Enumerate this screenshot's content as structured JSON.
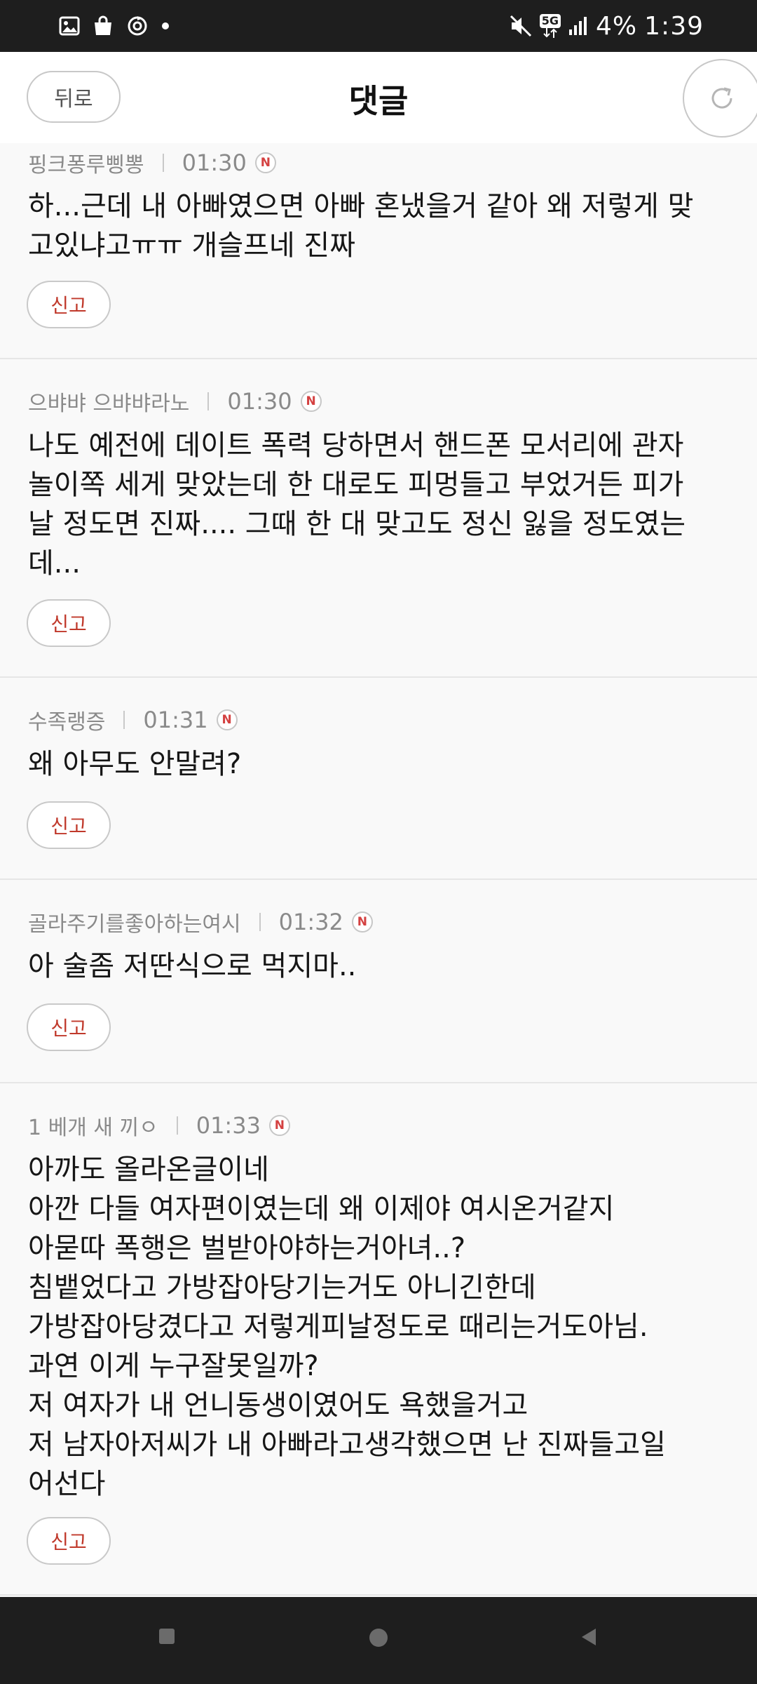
{
  "status_bar": {
    "left_icons": [
      "image-icon",
      "shopping-bag-icon",
      "sync-icon",
      "dot-icon"
    ],
    "network": "5G",
    "battery": "4%",
    "time": "1:39"
  },
  "header": {
    "back_label": "뒤로",
    "title": "댓글",
    "refresh_icon": "refresh-icon"
  },
  "comments": [
    {
      "author": "핑크퐁루삥뽕",
      "time": "01:30",
      "badge": "N",
      "body": "하...근데 내 아빠였으면 아빠 혼냈을거 같아 왜 저렇게 맞\n고있냐고ㅠㅠ 개슬프네 진짜",
      "report_label": "신고"
    },
    {
      "author": "으뱌뱌 으뱌뱌라노",
      "time": "01:30",
      "badge": "N",
      "body": "나도 예전에 데이트 폭력 당하면서 핸드폰 모서리에 관자\n놀이쪽 세게 맞았는데 한 대로도 피멍들고 부었거든 피가\n날 정도면 진짜.... 그때 한 대 맞고도 정신 잃을 정도였는\n데...",
      "report_label": "신고"
    },
    {
      "author": "수족랭증",
      "time": "01:31",
      "badge": "N",
      "body": "왜 아무도 안말려?",
      "report_label": "신고"
    },
    {
      "author": "골라주기를좋아하는여시",
      "time": "01:32",
      "badge": "N",
      "body": "아 술좀 저딴식으로 먹지마..",
      "report_label": "신고"
    },
    {
      "author": "1 베개 새 끼ㅇ",
      "time": "01:33",
      "badge": "N",
      "body": "아까도 올라온글이네\n아깐 다들 여자편이였는데 왜 이제야 여시온거같지\n아묻따 폭행은 벌받아야하는거아녀..?\n침뱉었다고 가방잡아당기는거도 아니긴한데\n가방잡아당겼다고 저렇게피날정도로 때리는거도아님.\n과연 이게 누구잘못일까?\n저 여자가 내 언니동생이였어도 욕했을거고\n저 남자아저씨가 내 아빠라고생각했으면 난 진짜들고일\n어선다",
      "report_label": "신고"
    }
  ],
  "nav_bar": {
    "items": [
      "recents-icon",
      "home-icon",
      "back-icon"
    ]
  }
}
